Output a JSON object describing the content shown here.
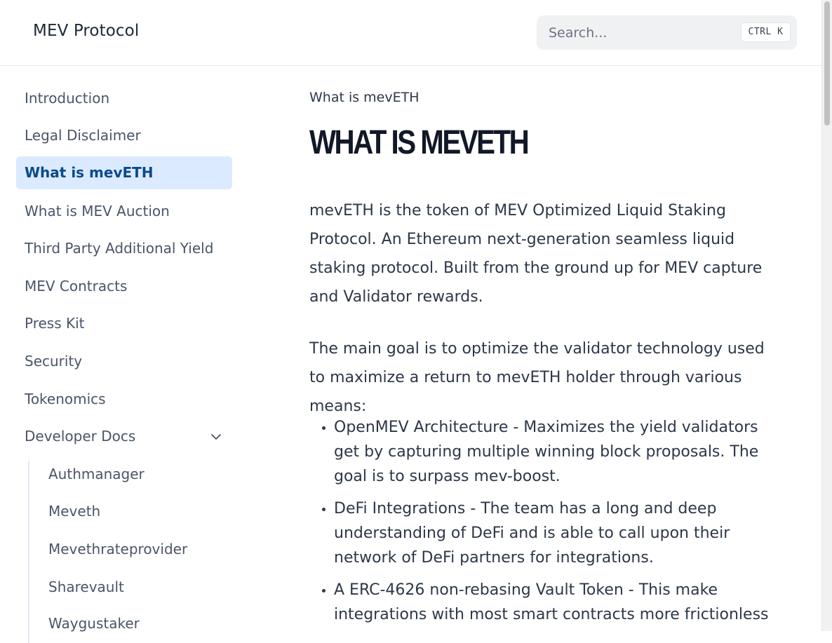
{
  "header": {
    "brand": "MEV Protocol",
    "search_placeholder": "Search...",
    "search_shortcut": "CTRL K"
  },
  "sidebar": {
    "items": [
      {
        "label": "Introduction"
      },
      {
        "label": "Legal Disclaimer"
      },
      {
        "label": "What is mevETH",
        "active": true
      },
      {
        "label": "What is MEV Auction"
      },
      {
        "label": "Third Party Additional Yield"
      },
      {
        "label": "MEV Contracts"
      },
      {
        "label": "Press Kit"
      },
      {
        "label": "Security"
      },
      {
        "label": "Tokenomics"
      },
      {
        "label": "Developer Docs",
        "expanded": true,
        "icon": "chevron-down-icon"
      }
    ],
    "sub_items": [
      {
        "label": "Authmanager"
      },
      {
        "label": "Meveth"
      },
      {
        "label": "Mevethrateprovider"
      },
      {
        "label": "Sharevault"
      },
      {
        "label": "Waygustaker"
      }
    ]
  },
  "main": {
    "breadcrumb": "What is mevETH",
    "title": "What is mevETH",
    "paragraphs": [
      "mevETH is the token of MEV Optimized Liquid Staking Protocol. An Ethereum next-generation seamless liquid staking protocol. Built from the ground up for MEV capture and Validator rewards.",
      "The main goal is to optimize the validator technology used to maximize a return to mevETH holder through various means:"
    ],
    "bullets": [
      "OpenMEV Architecture - Maximizes the yield validators get by capturing multiple winning block proposals. The goal is to surpass mev-boost.",
      "DeFi Integrations - The team has a long and deep understanding of DeFi and is able to call upon their network of DeFi partners for integrations.",
      "A ERC-4626 non-rebasing Vault Token - This make integrations with most smart contracts more frictionless"
    ]
  },
  "colors": {
    "active_bg": "#dbeafe",
    "active_text": "#0b4a8b",
    "text": "#2d3748",
    "title": "#111827"
  }
}
